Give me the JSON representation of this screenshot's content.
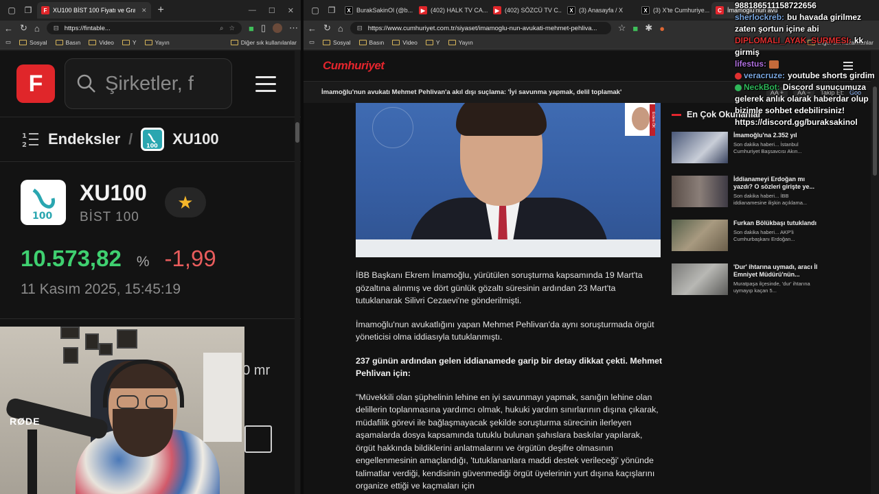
{
  "left_browser": {
    "tabs": [
      {
        "label": "XU100 BİST 100 Fiyatı ve Grafikleri",
        "favicon": "F",
        "active": true
      }
    ],
    "url": "https://fintable...",
    "bookmarks": [
      "Sosyal",
      "Basın",
      "Video",
      "Y",
      "Yayın"
    ],
    "bookmarks_right": "Diğer sık kullanılanlar"
  },
  "fintables": {
    "logo_letter": "F",
    "search_placeholder": "Şirketler, f",
    "breadcrumb_root": "Endeksler",
    "breadcrumb_current": "XU100",
    "index_icon_text": "100",
    "symbol": "XU100",
    "name": "BİST 100",
    "price": "10.573,82",
    "percent_sign": "%",
    "change": "-1,99",
    "timestamp": "11 Kasım 2025, 15:45:19",
    "stat_label": "m",
    "stat_value": "70 mr",
    "colors": {
      "up": "#3fd070",
      "down": "#e85c5c",
      "brand": "#e0262a"
    }
  },
  "webcam": {
    "mic_brand": "RØDE"
  },
  "right_browser": {
    "tabs": [
      {
        "label": "BurakSakinOl (@b...",
        "favicon": "X",
        "color": "#000000"
      },
      {
        "label": "(402) HALK TV CA...",
        "favicon": "▶",
        "color": "#e0262a"
      },
      {
        "label": "(402) SÖZCÜ TV C...",
        "favicon": "▶",
        "color": "#e0262a"
      },
      {
        "label": "(3) Anasayfa / X",
        "favicon": "X",
        "color": "#000000"
      },
      {
        "label": "(3) X'te Cumhuriye...",
        "favicon": "X",
        "color": "#000000"
      },
      {
        "label": "İmamoğlu'nun avu...",
        "favicon": "C",
        "color": "#e3252d",
        "active": true
      }
    ],
    "url": "https://www.cumhuriyet.com.tr/siyaset/imamoglu-nun-avukati-mehmet-pehliva...",
    "bookmarks": [
      "Sosyal",
      "Basın",
      "Video",
      "Y",
      "Yayın"
    ],
    "bookmarks_right": "Diğer sık kullanılanlar"
  },
  "cumhuriyet": {
    "logo": "Cumhuriyet",
    "ticker": "İmamoğlu'nun avukatı Mehmet Pehlivan'a akıl dışı suçlama: 'İyi savunma yapmak, delil toplamak'",
    "tools": {
      "font_small": "AA",
      "plus": "+",
      "minus": "−",
      "follow": "Takip Et:",
      "google": "Goo"
    },
    "hero_inset_caption": "Erdem ÖK",
    "paragraphs": [
      {
        "text": "İBB Başkanı Ekrem İmamoğlu, yürütülen soruşturma kapsamında 19 Mart'ta gözaltına alınmış ve dört günlük gözaltı süresinin ardından 23 Mart'ta tutuklanarak Silivri Cezaevi'ne gönderilmişti.",
        "bold": false
      },
      {
        "text": "İmamoğlu'nun avukatlığını yapan Mehmet Pehlivan'da aynı soruşturmada örgüt yöneticisi olma iddiasıyla tutuklanmıştı.",
        "bold": false
      },
      {
        "text": "237 günün ardından gelen iddianamede garip bir detay dikkat çekti. Mehmet Pehlivan için:",
        "bold": true
      },
      {
        "text": "\"Müvekkili olan şüphelinin lehine en iyi savunmayı yapmak, sanığın lehine olan delillerin toplanmasına yardımcı olmak, hukuki yardım sınırlarının dışına çıkarak, müdafilik görevi ile bağlaşmayacak şekilde soruşturma sürecinin ilerleyen aşamalarda dosya kapsamında tutuklu bulunan şahıslara baskılar yapılarak, örgüt hakkında bildiklerini anlatmalarını ve örgütün deşifre olmasının engellenmesinin amaçlandığı, 'tutuklananlara maddi destek verileceği' yönünde talimatlar verdiği, kendisinin güvenmediği örgüt üyelerinin yurt dışına kaçışlarını organize ettiği ve kaçmaları için",
        "bold": false
      }
    ],
    "sidebar_title": "En Çok Okunanlar",
    "sidebar_items": [
      {
        "title": "İmamoğlu'na 2.352 yıl",
        "snippet": "Son dakika haberi... İstanbul Cumhuriyet Başsavcısı Akın...",
        "thumb": "#4a5878"
      },
      {
        "title": "İddianameyi Erdoğan mı yazdı? O sözleri girişte ye...",
        "snippet": "Son dakika haberi... İBB iddianamesine ilişkin açıklama...",
        "thumb": "#5a4e48"
      },
      {
        "title": "Furkan Bölükbaşı tutuklandı",
        "snippet": "Son dakika haberi... AKP'li Cumhurbaşkanı Erdoğan...",
        "thumb": "#55604a"
      },
      {
        "title": "'Dur' ihtarına uymadı, aracı İl Emniyet Müdürü'nün...",
        "snippet": "Muratpaşa ilçesinde, 'dur' ihtarına uymayıp kaçan 5...",
        "thumb": "#7a7a78"
      }
    ]
  },
  "chat": [
    {
      "user": "",
      "msg": "98818651115872265​6",
      "user_color": "#ffffff"
    },
    {
      "user": "sherlockreb:",
      "msg": "bu havada girilmez zaten şortun içine abi",
      "user_color": "#7aa7e0"
    },
    {
      "user": "DIPLOMALI_AYAK_SURMESI:",
      "msg": "kk girmiş",
      "user_color": "#e03030"
    },
    {
      "user": "lifestus:",
      "msg": "",
      "user_color": "#b070e0"
    },
    {
      "user": "veracruze:",
      "msg": "youtube shorts girdim",
      "user_color": "#7aa7e0"
    },
    {
      "user": "NeckBot:",
      "msg": "Discord sunucumuza gelerek anlık olarak haberdar olup bizimle sohbet edebilirsiniz! https://discord.gg/buraksakinol",
      "user_color": "#2fb85a"
    }
  ]
}
